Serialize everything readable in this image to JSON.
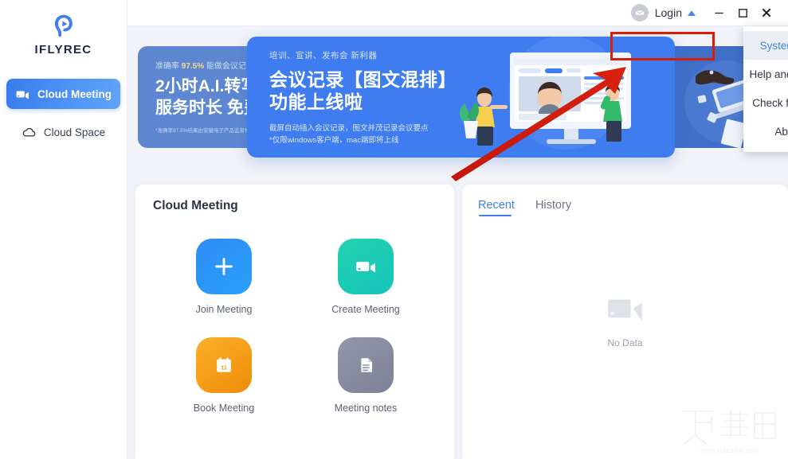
{
  "brand": {
    "name": "IFLYREC",
    "logo_icon": "ear-play-logo-icon",
    "accent": "#3e7cf0"
  },
  "sidebar": {
    "items": [
      {
        "label": "Cloud Meeting",
        "icon": "video-camera-icon",
        "active": true
      },
      {
        "label": "Cloud Space",
        "icon": "cloud-icon",
        "active": false
      }
    ]
  },
  "titlebar": {
    "avatar_icon": "default-avatar-icon",
    "login_label": "Login",
    "caret_icon": "caret-up-icon",
    "minimize_icon": "minimize-icon",
    "maximize_icon": "maximize-icon",
    "close_icon": "close-icon"
  },
  "menu": {
    "items": [
      {
        "label": "System Setting",
        "selected": true
      },
      {
        "label": "Help and Feedback",
        "selected": false
      },
      {
        "label": "Check for updates",
        "selected": false
      },
      {
        "label": "About us",
        "selected": false
      }
    ]
  },
  "annotations": {
    "highlight_color": "#d81e06",
    "highlight_target": "System Setting",
    "arrow_color": "#cc1f0f",
    "arrow_target": "Help and Feedback"
  },
  "banner": {
    "main_slide": {
      "kicker": "培训、宣讲、发布会 新利器",
      "headline_line1": "会议记录【图文混排】",
      "headline_line2": "功能上线啦",
      "sub_line1": "截屏自动插入会议记录，图文并茂记录会议要点",
      "sub_line2": "*仅限windows客户端，mac端即将上线"
    },
    "left_slide": {
      "kicker_pre": "准确率",
      "kicker_hi": "97.5%",
      "kicker_post": "能做会议记",
      "headline_line1": "2小时A.I.转写",
      "headline_line2": "服务时长 免费",
      "note": "*准确率97.5%结果由安徽电子产品监督检"
    },
    "dots": [
      {
        "active": false
      },
      {
        "active": false
      },
      {
        "active": true
      }
    ]
  },
  "meeting_panel": {
    "title": "Cloud Meeting",
    "tiles": [
      {
        "label": "Join Meeting",
        "icon": "plus-icon",
        "color_from": "#2e8cf5",
        "color_to": "#2a9ef9"
      },
      {
        "label": "Create Meeting",
        "icon": "video-camera-icon",
        "color_from": "#1fd0ae",
        "color_to": "#19c6b6"
      },
      {
        "label": "Book Meeting",
        "icon": "calendar-icon",
        "color_from": "#f9a720",
        "color_to": "#f08d0c"
      },
      {
        "label": "Meeting notes",
        "icon": "document-icon",
        "color_from": "#8d93a6",
        "color_to": "#7e8497"
      }
    ]
  },
  "recent_panel": {
    "tabs": [
      {
        "label": "Recent",
        "active": true
      },
      {
        "label": "History",
        "active": false
      }
    ],
    "empty_icon": "video-camera-icon",
    "empty_label": "No Data"
  },
  "watermark": {
    "text_cn": "下载吧",
    "text_url": "www.xiazaiba.com"
  }
}
